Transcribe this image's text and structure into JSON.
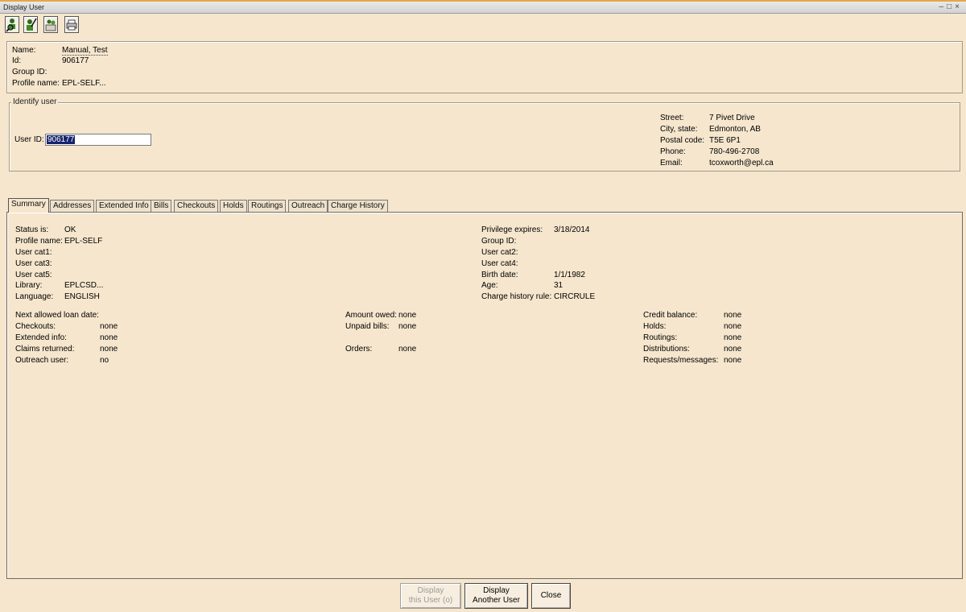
{
  "window": {
    "title": "Display User",
    "controls": [
      "–",
      "□",
      "×"
    ]
  },
  "toolbar": {
    "icons": [
      "user-search-icon",
      "user-edit-icon",
      "user-group-icon",
      "print-icon"
    ]
  },
  "summary_box": {
    "name_label": "Name:",
    "name_value": "Manual, Test",
    "id_label": "Id:",
    "id_value": "906177",
    "group_label": "Group ID:",
    "profile_label": "Profile name:",
    "profile_value": "EPL-SELF..."
  },
  "identify": {
    "legend": "Identify user",
    "userid_label": "User ID:",
    "userid_value": "906177",
    "street_label": "Street:",
    "street_value": "7 Pivet Drive",
    "city_label": "City, state:",
    "city_value": "Edmonton, AB",
    "postal_label": "Postal code:",
    "postal_value": "T5E 6P1",
    "phone_label": "Phone:",
    "phone_value": "780-496-2708",
    "email_label": "Email:",
    "email_value": "tcoxworth@epl.ca"
  },
  "tabs": [
    "Summary",
    "Addresses",
    "Extended Info",
    "Bills",
    "Checkouts",
    "Holds",
    "Routings",
    "Outreach",
    "Charge History"
  ],
  "summary": {
    "status_label": "Status is:",
    "status_value": "OK",
    "profile_label": "Profile name:",
    "profile_value": "EPL-SELF",
    "cat1_label": "User cat1:",
    "cat3_label": "User cat3:",
    "cat5_label": "User cat5:",
    "library_label": "Library:",
    "library_value": "EPLCSD...",
    "language_label": "Language:",
    "language_value": "ENGLISH",
    "priv_label": "Privilege expires:",
    "priv_value": "3/18/2014",
    "group_label": "Group ID:",
    "cat2_label": "User cat2:",
    "cat4_label": "User cat4:",
    "birth_label": "Birth date:",
    "birth_value": "1/1/1982",
    "age_label": "Age:",
    "age_value": "31",
    "charge_label": "Charge history rule:",
    "charge_value": "CIRCRULE",
    "next_loan_label": "Next allowed loan date:",
    "checkouts_label": "Checkouts:",
    "checkouts_value": "none",
    "ext_label": "Extended info:",
    "ext_value": "none",
    "claims_label": "Claims returned:",
    "claims_value": "none",
    "outreach_label": "Outreach user:",
    "outreach_value": "no",
    "owed_label": "Amount owed:",
    "owed_value": "none",
    "unpaid_label": "Unpaid bills:",
    "unpaid_value": "none",
    "orders_label": "Orders:",
    "orders_value": "none",
    "credit_label": "Credit balance:",
    "credit_value": "none",
    "holds_label": "Holds:",
    "holds_value": "none",
    "routings_label": "Routings:",
    "routings_value": "none",
    "dist_label": "Distributions:",
    "dist_value": "none",
    "requests_label": "Requests/messages:",
    "requests_value": "none"
  },
  "buttons": {
    "display_this_line1": "Display",
    "display_this_line2": "this User (o)",
    "display_another_line1": "Display",
    "display_another_line2": "Another User",
    "close": "Close"
  }
}
